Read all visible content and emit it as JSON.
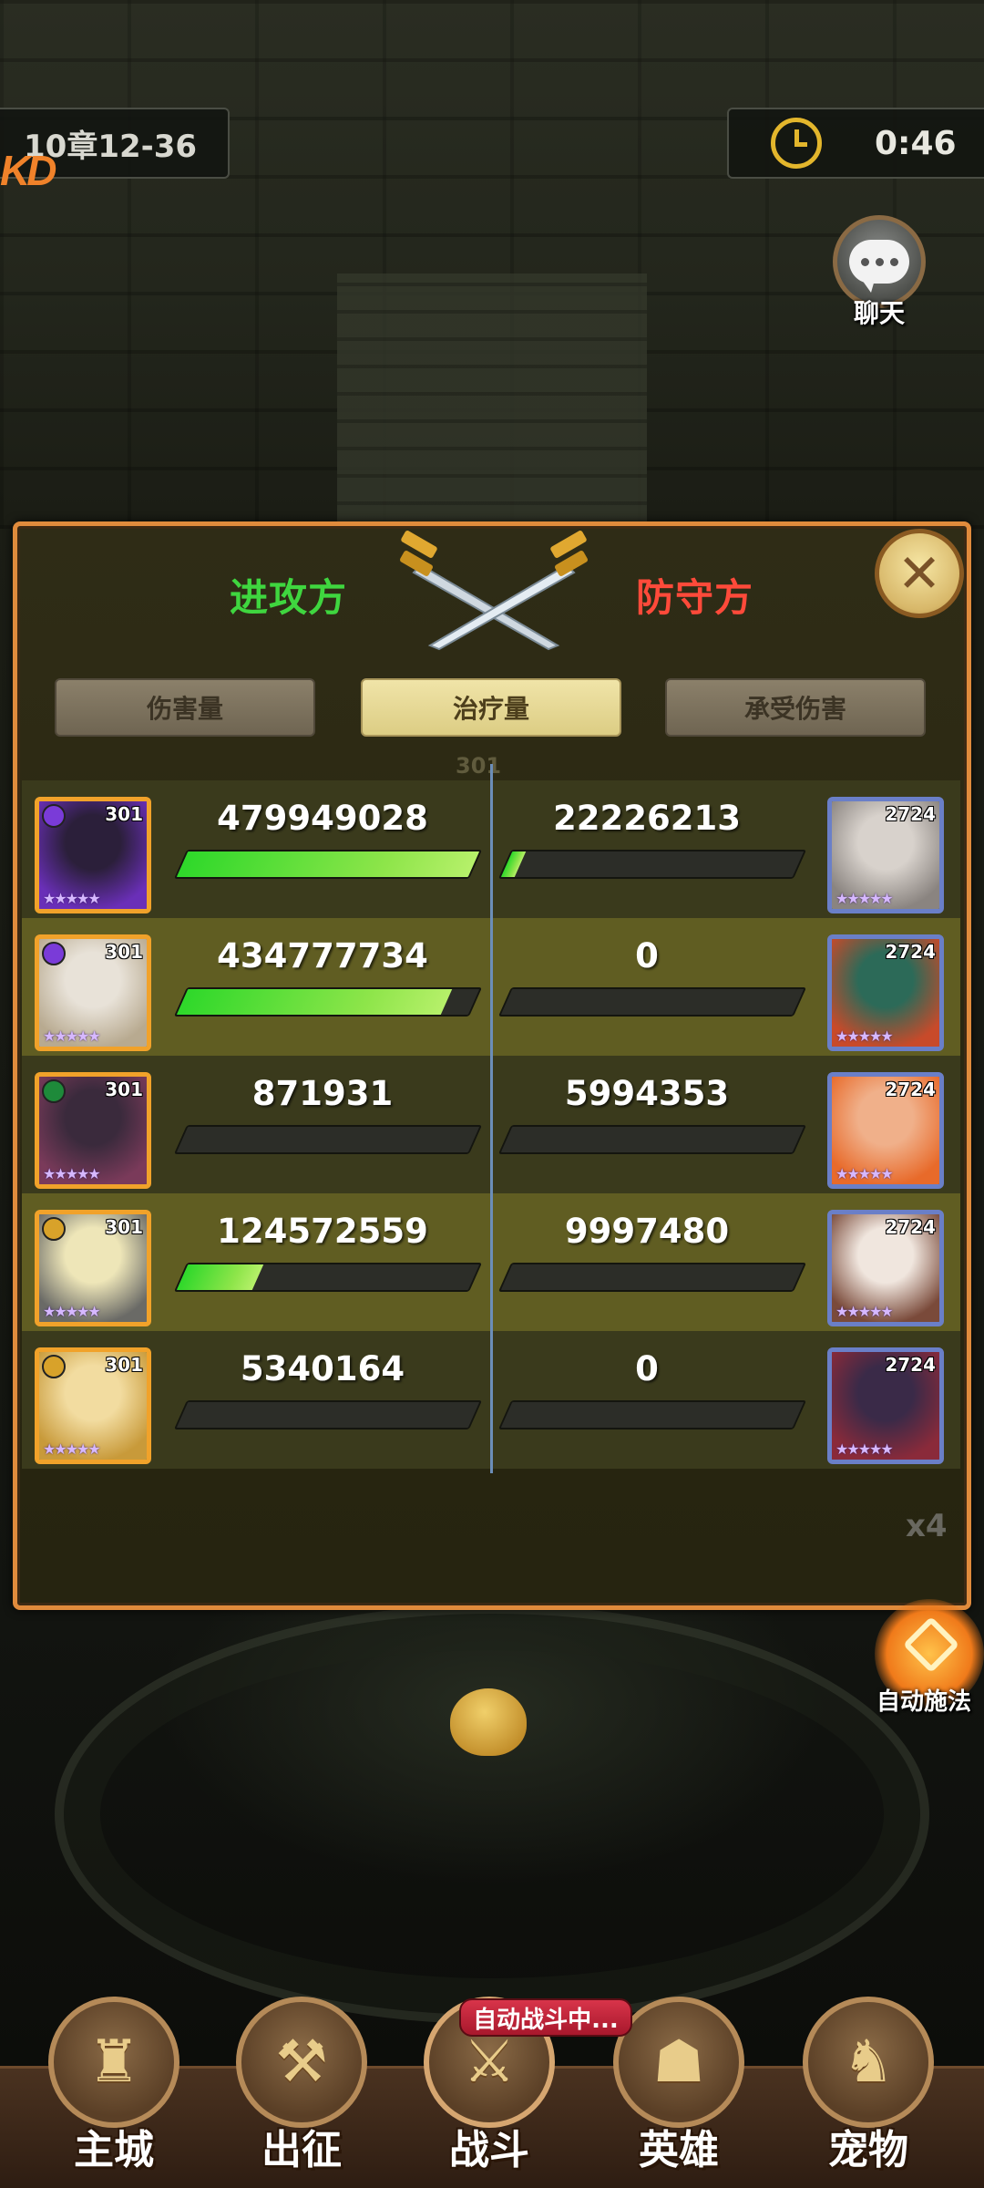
{
  "hud": {
    "stage": "10章12-36",
    "corner_mark": "KD",
    "timer": "0:46",
    "chat_label": "聊天"
  },
  "panel": {
    "attack_label": "进攻方",
    "defend_label": "防守方",
    "tabs": [
      {
        "label": "伤害量",
        "active": false
      },
      {
        "label": "治疗量",
        "active": true
      },
      {
        "label": "承受伤害",
        "active": false
      }
    ],
    "faded_level": "301",
    "rows": [
      {
        "left": {
          "level": "301",
          "value": "479949028",
          "fill": 1.0,
          "badge": "#7a3bd8",
          "face": [
            "#2b1f3a",
            "#6a2fb8"
          ]
        },
        "right": {
          "level": "2724",
          "value": "22226213",
          "fill": 0.046,
          "badge": "",
          "face": [
            "#d8d2cc",
            "#8a8480"
          ]
        }
      },
      {
        "left": {
          "level": "301",
          "value": "434777734",
          "fill": 0.906,
          "badge": "#7a3bd8",
          "face": [
            "#e8e2d8",
            "#b8aa90"
          ]
        },
        "right": {
          "level": "2724",
          "value": "0",
          "fill": 0,
          "badge": "",
          "face": [
            "#2c6a58",
            "#c84a2a"
          ]
        }
      },
      {
        "left": {
          "level": "301",
          "value": "871931",
          "fill": 0,
          "badge": "#1e8a3a",
          "face": [
            "#3a2a3c",
            "#7a3a5a"
          ]
        },
        "right": {
          "level": "2724",
          "value": "5994353",
          "fill": 0,
          "badge": "",
          "face": [
            "#f0b08a",
            "#e86a2a"
          ]
        }
      },
      {
        "left": {
          "level": "301",
          "value": "124572559",
          "fill": 0.26,
          "badge": "#d8a22a",
          "face": [
            "#eee6b8",
            "#6a6a66"
          ]
        },
        "right": {
          "level": "2724",
          "value": "9997480",
          "fill": 0,
          "badge": "",
          "face": [
            "#f0e6de",
            "#7a4a3a"
          ]
        }
      },
      {
        "left": {
          "level": "301",
          "value": "5340164",
          "fill": 0,
          "badge": "#d8a22a",
          "face": [
            "#f2dca0",
            "#c89a3a"
          ]
        },
        "right": {
          "level": "2724",
          "value": "0",
          "fill": 0,
          "badge": "",
          "face": [
            "#3a2a48",
            "#8a2a3a"
          ]
        }
      }
    ]
  },
  "controls": {
    "speed": "x4",
    "auto_cast_label": "自动施法"
  },
  "nav": {
    "auto_battle_tag": "自动战斗中...",
    "items": [
      {
        "label": "主城",
        "icon": "castle-icon"
      },
      {
        "label": "出征",
        "icon": "crossed-axes-icon"
      },
      {
        "label": "战斗",
        "icon": "battle-icon"
      },
      {
        "label": "英雄",
        "icon": "hooded-hero-icon"
      },
      {
        "label": "宠物",
        "icon": "dragon-pet-icon"
      }
    ]
  },
  "colors": {
    "attack": "#3fd63f",
    "defend": "#ff4a3a",
    "panel_border": "#e08b3c",
    "bar_fill": "#2ed82a"
  }
}
